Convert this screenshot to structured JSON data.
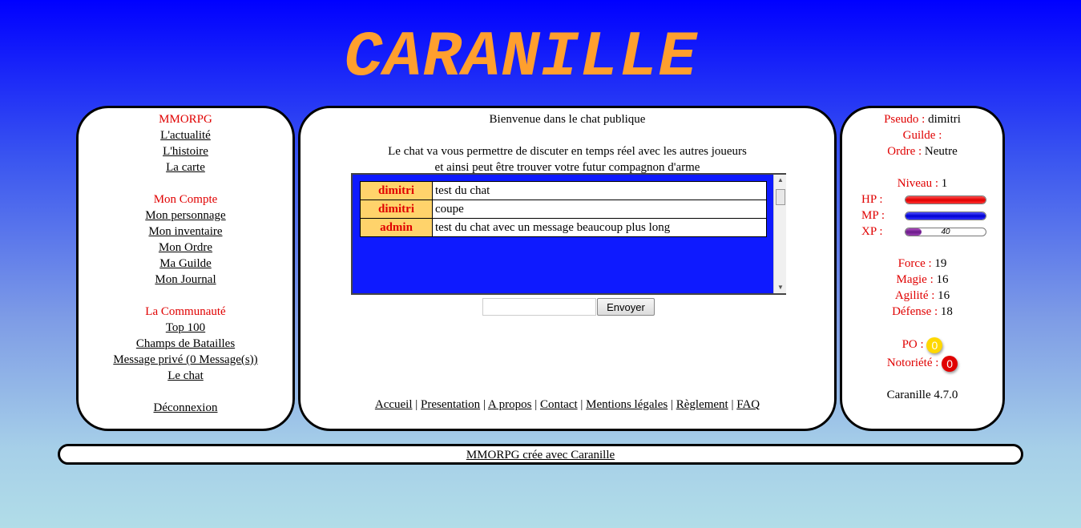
{
  "title": "CARANILLE",
  "left": {
    "section1": "MMORPG",
    "links1": [
      "L'actualité",
      "L'histoire",
      "La carte"
    ],
    "section2": "Mon Compte",
    "links2": [
      "Mon personnage",
      "Mon inventaire",
      "Mon Ordre",
      "Ma Guilde",
      "Mon Journal"
    ],
    "section3": "La Communauté",
    "links3": [
      "Top 100",
      "Champs de Batailles",
      "Message privé (0 Message(s))",
      "Le chat"
    ],
    "logout": "Déconnexion"
  },
  "center": {
    "welcome": "Bienvenue dans le chat publique",
    "intro1": "Le chat va vous permettre de discuter en temps réel avec les autres joueurs",
    "intro2": "et ainsi peut être trouver votre futur compagnon d'arme",
    "messages": [
      {
        "user": "dimitri",
        "text": "test du chat"
      },
      {
        "user": "dimitri",
        "text": "coupe"
      },
      {
        "user": "admin",
        "text": "test du chat avec un message beaucoup plus long"
      }
    ],
    "input_value": "",
    "send_label": "Envoyer",
    "nav": [
      "Accueil",
      "Presentation",
      "A propos",
      "Contact",
      "Mentions légales",
      "Règlement",
      "FAQ"
    ]
  },
  "right": {
    "pseudo_label": "Pseudo :",
    "pseudo": "dimitri",
    "guilde_label": "Guilde :",
    "guilde": "",
    "ordre_label": "Ordre :",
    "ordre": "Neutre",
    "niveau_label": "Niveau :",
    "niveau": "1",
    "hp_label": "HP :",
    "hp_fraction": 1.0,
    "mp_label": "MP :",
    "mp_fraction": 1.0,
    "xp_label": "XP :",
    "xp_value": "40",
    "xp_fraction": 0.2,
    "force_label": "Force :",
    "force": "19",
    "magie_label": "Magie :",
    "magie": "16",
    "agilite_label": "Agilité :",
    "agilite": "16",
    "defense_label": "Défense :",
    "defense": "18",
    "po_label": "PO :",
    "po": "0",
    "noto_label": "Notoriété :",
    "noto": "0",
    "version": "Caranille 4.7.0"
  },
  "footer": "MMORPG crée avec Caranille",
  "colors": {
    "accent_red": "#e00000",
    "title_orange": "#ff9f2e",
    "chat_bg": "#0e1aff",
    "user_cell": "#ffd36b"
  }
}
